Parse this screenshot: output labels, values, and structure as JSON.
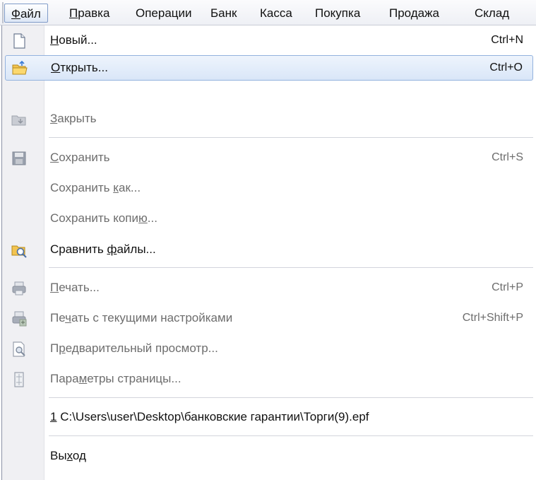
{
  "menubar": {
    "items": [
      {
        "pre": "",
        "u": "Ф",
        "post": "айл"
      },
      {
        "pre": "",
        "u": "П",
        "post": "равка"
      },
      {
        "pre": "",
        "u": "",
        "post": "Операции"
      },
      {
        "pre": "",
        "u": "",
        "post": "Банк"
      },
      {
        "pre": "",
        "u": "",
        "post": "Касса"
      },
      {
        "pre": "",
        "u": "",
        "post": "Покупка"
      },
      {
        "pre": "",
        "u": "",
        "post": "Продажа"
      },
      {
        "pre": "",
        "u": "",
        "post": "Склад"
      }
    ]
  },
  "menu": {
    "new": {
      "pre": "",
      "u": "Н",
      "post": "овый...",
      "shortcut": "Ctrl+N"
    },
    "open": {
      "pre": "",
      "u": "О",
      "post": "ткрыть...",
      "shortcut": "Ctrl+O"
    },
    "close": {
      "pre": "",
      "u": "З",
      "post": "акрыть"
    },
    "save": {
      "pre": "",
      "u": "С",
      "post": "охранить",
      "shortcut": "Ctrl+S"
    },
    "save_as": {
      "pre": "Сохранить ",
      "u": "к",
      "post": "ак..."
    },
    "save_copy": {
      "pre": "Сохранить копи",
      "u": "ю",
      "post": "..."
    },
    "compare": {
      "pre": "Сравнить ",
      "u": "ф",
      "post": "айлы..."
    },
    "print": {
      "pre": "",
      "u": "П",
      "post": "ечать...",
      "shortcut": "Ctrl+P"
    },
    "print_current": {
      "pre": "Пе",
      "u": "ч",
      "post": "ать с текущими настройками",
      "shortcut": "Ctrl+Shift+P"
    },
    "preview": {
      "pre": "П",
      "u": "р",
      "post": "едварительный просмотр..."
    },
    "page_setup": {
      "pre": "Пара",
      "u": "м",
      "post": "етры страницы..."
    },
    "recent": {
      "pre": "",
      "u": "1",
      "post": " C:\\Users\\user\\Desktop\\банковские гарантии\\Торги(9).epf"
    },
    "exit": {
      "pre": "Вы",
      "u": "х",
      "post": "од"
    }
  },
  "colors": {
    "hover_border": "#93b2de",
    "disabled_text": "#6d6d6d"
  },
  "icons": {
    "new": "document-icon",
    "open": "open-folder-icon",
    "close": "close-folder-icon",
    "save": "floppy-disk-icon",
    "compare": "compare-files-icon",
    "print": "printer-icon",
    "print_current": "printer-settings-icon",
    "preview": "print-preview-icon",
    "page_setup": "page-setup-icon"
  }
}
